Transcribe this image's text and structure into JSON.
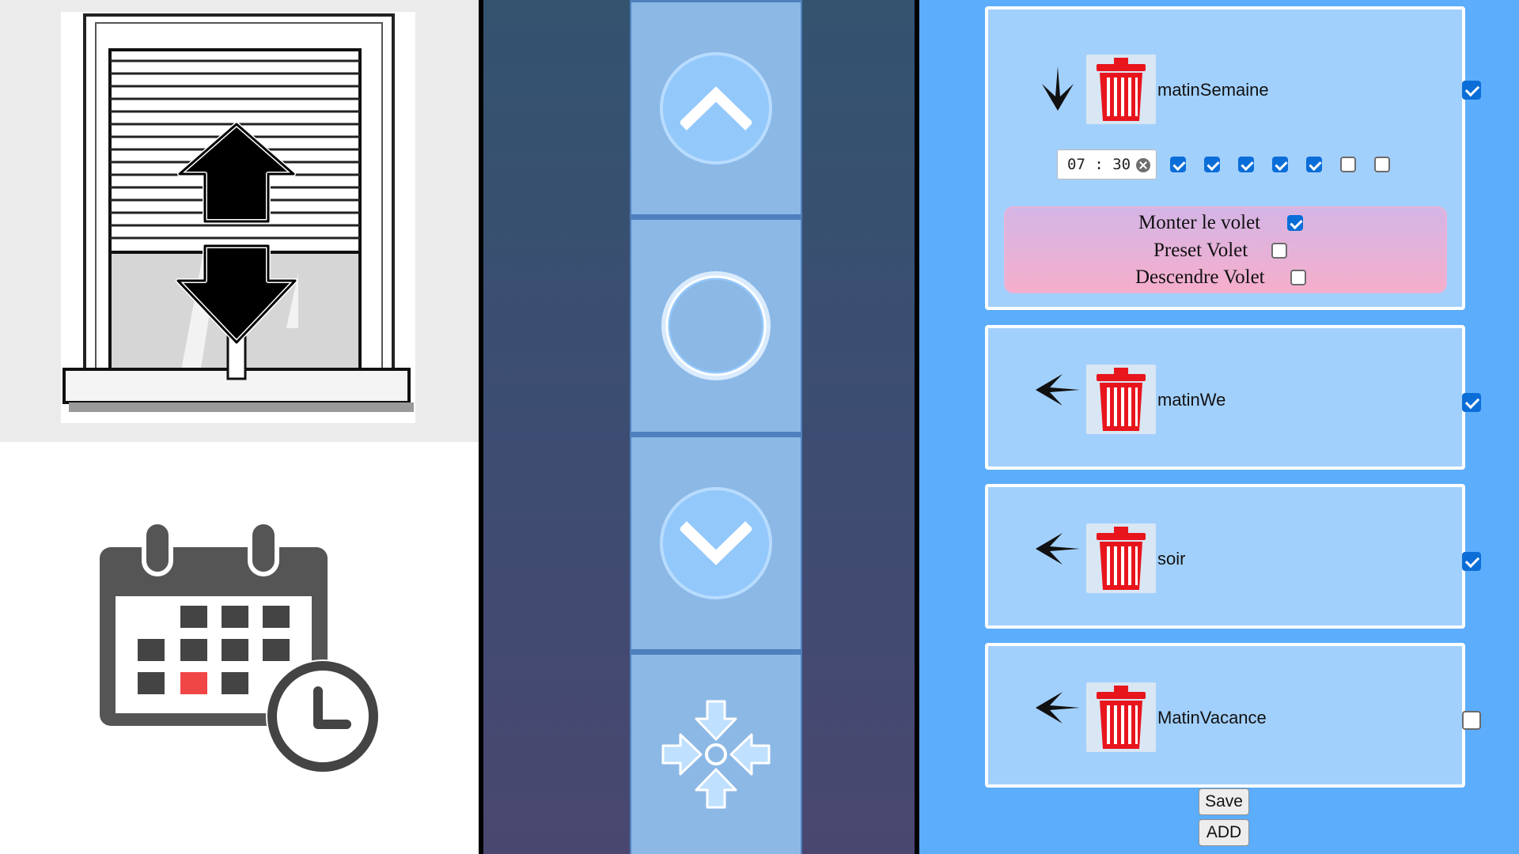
{
  "left": {
    "shutter_tile": {
      "icon": "window-shutter-updown-icon"
    },
    "schedule_tile": {
      "icon": "calendar-clock-icon"
    }
  },
  "remote": {
    "up": {
      "icon": "chevron-up-icon"
    },
    "stop": {
      "icon": "stop-ring-icon"
    },
    "down": {
      "icon": "chevron-down-icon"
    },
    "preset": {
      "icon": "arrows-to-center-icon"
    }
  },
  "programs": [
    {
      "name": "matinSemaine",
      "enabled": true,
      "expanded": true,
      "arrow": "arrow-down-icon",
      "time": "07 : 30",
      "days": [
        true,
        true,
        true,
        true,
        true,
        false,
        false
      ],
      "actions": [
        {
          "label": "Monter le volet",
          "checked": true
        },
        {
          "label": "Preset Volet",
          "checked": false
        },
        {
          "label": "Descendre Volet",
          "checked": false
        }
      ]
    },
    {
      "name": "matinWe",
      "enabled": true,
      "expanded": false,
      "arrow": "arrow-right-icon"
    },
    {
      "name": "soir",
      "enabled": true,
      "expanded": false,
      "arrow": "arrow-right-icon"
    },
    {
      "name": "MatinVacance",
      "enabled": false,
      "expanded": false,
      "arrow": "arrow-right-icon"
    }
  ],
  "buttons": {
    "save": "Save",
    "add": "ADD"
  },
  "colors": {
    "right_bg": "#5cadfc",
    "card_bg": "#a2d0fd",
    "remote_button": "#8cb8e6",
    "trash_red": "#e8151d",
    "checkbox_blue": "#0b6ed8"
  }
}
